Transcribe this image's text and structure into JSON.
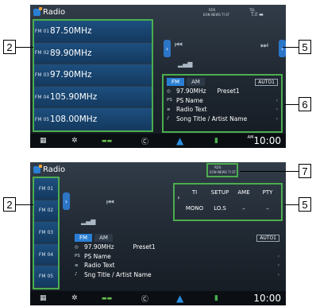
{
  "top": {
    "title": "Radio",
    "status_rds": "RDS",
    "status_mid": "EON NEWS TI ST",
    "status_tel": "TEL",
    "presets": [
      {
        "label": "FM 01",
        "freq": "87.50MHz"
      },
      {
        "label": "FM 02",
        "freq": "89.90MHz"
      },
      {
        "label": "FM 03",
        "freq": "97.90MHz"
      },
      {
        "label": "FM 04",
        "freq": "105.90MHz"
      },
      {
        "label": "FM 05",
        "freq": "108.00MHz"
      }
    ],
    "band_fm": "FM",
    "band_am": "AM",
    "auto": "AUTO1",
    "freq": "97.90MHz",
    "preset": "Preset1",
    "ps_label": "PS",
    "ps_name": "PS Name",
    "radio_text": "Radio Text",
    "song": "Song Title / Artist Name",
    "clock_prefix": "AM",
    "clock": "10:00"
  },
  "bottom": {
    "title": "Radio",
    "status_rds": "RDS",
    "status_mid": "EON NEWS TI ST",
    "presets": [
      "FM 01",
      "FM 02",
      "FM 03",
      "FM 04",
      "FM 05"
    ],
    "band_fm": "FM",
    "band_am": "AM",
    "auto": "AUTO1",
    "freq": "97.90MHz",
    "preset": "Preset1",
    "ps_label": "PS",
    "ps_name": "PS Name",
    "radio_text": "Radio Text",
    "song": "Sng Title / Artist Name",
    "fn_row1": [
      "TI",
      "SETUP",
      "AME",
      "PTY"
    ],
    "fn_row2": [
      "MONO",
      "LO.S",
      "–",
      "–"
    ],
    "clock": "10:00"
  },
  "callouts": {
    "c2a": "2",
    "c5a": "5",
    "c6": "6",
    "c2b": "2",
    "c7": "7",
    "c5b": "5"
  }
}
